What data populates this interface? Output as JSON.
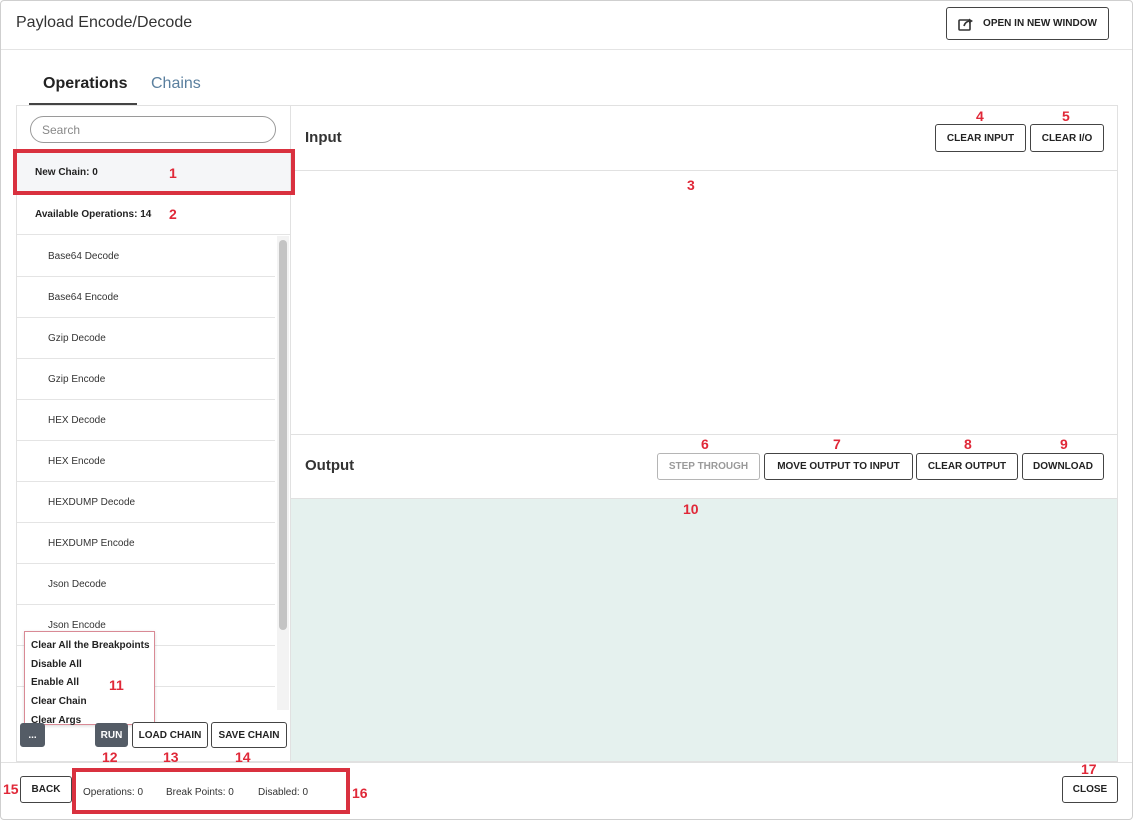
{
  "window": {
    "title": "Payload Encode/Decode",
    "open_new_window_label": "OPEN IN NEW WINDOW"
  },
  "tabs": [
    {
      "label": "Operations",
      "active": true
    },
    {
      "label": "Chains",
      "active": false
    }
  ],
  "sidebar": {
    "search_placeholder": "Search",
    "new_chain_label": "New Chain: 0",
    "available_label": "Available Operations: 14",
    "operations": [
      "Base64 Decode",
      "Base64 Encode",
      "Gzip Decode",
      "Gzip Encode",
      "HEX Decode",
      "HEX Encode",
      "HEXDUMP Decode",
      "HEXDUMP Encode",
      "Json Decode",
      "Json Encode",
      "",
      ""
    ],
    "menu_items": [
      "Clear All the Breakpoints",
      "Disable All",
      "Enable All",
      "Clear Chain",
      "Clear Args"
    ],
    "more_label": "...",
    "run_label": "RUN",
    "load_chain_label": "LOAD CHAIN",
    "save_chain_label": "SAVE CHAIN"
  },
  "input": {
    "title": "Input",
    "clear_input_label": "CLEAR INPUT",
    "clear_io_label": "CLEAR I/O"
  },
  "output": {
    "title": "Output",
    "step_through_label": "STEP THROUGH",
    "move_output_label": "MOVE OUTPUT TO INPUT",
    "clear_output_label": "CLEAR OUTPUT",
    "download_label": "DOWNLOAD"
  },
  "footer": {
    "back_label": "BACK",
    "operations_label": "Operations: 0",
    "breakpoints_label": "Break Points: 0",
    "disabled_label": "Disabled: 0",
    "close_label": "CLOSE"
  },
  "annotations": [
    "1",
    "2",
    "3",
    "4",
    "5",
    "6",
    "7",
    "8",
    "9",
    "10",
    "11",
    "12",
    "13",
    "14",
    "15",
    "16",
    "17"
  ],
  "colors": {
    "annotation": "#e02838",
    "output_bg": "#e5f1ee",
    "tab_inactive": "#5a7f9e",
    "run_bg": "#545c66"
  }
}
